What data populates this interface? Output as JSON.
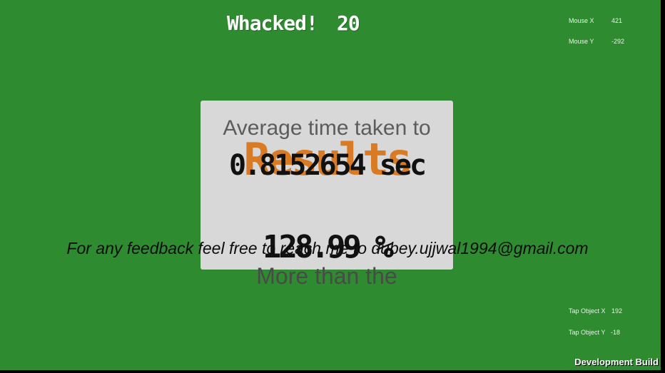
{
  "score": {
    "label": "Whacked!",
    "value": "20"
  },
  "debug": {
    "mouse_x_label": "Mouse X",
    "mouse_x_value": "421",
    "mouse_y_label": "Mouse Y",
    "mouse_y_value": "-292",
    "tap_x_label": "Tap Object X",
    "tap_x_value": "192",
    "tap_y_label": "Tap Object Y",
    "tap_y_value": "-18"
  },
  "results": {
    "title": "Results",
    "avg_label": "Average time taken to",
    "avg_value": "0.8152654 sec",
    "percent_value": "128.99 %",
    "more_than": "More than the"
  },
  "feedback": "For any feedback feel free to reach me to dubey.ujjwal1994@gmail.com",
  "dev_build": "Development Build",
  "colors": {
    "background": "#2e8b2f",
    "panel": "#d8d8d8",
    "results_title": "#d97a25"
  }
}
